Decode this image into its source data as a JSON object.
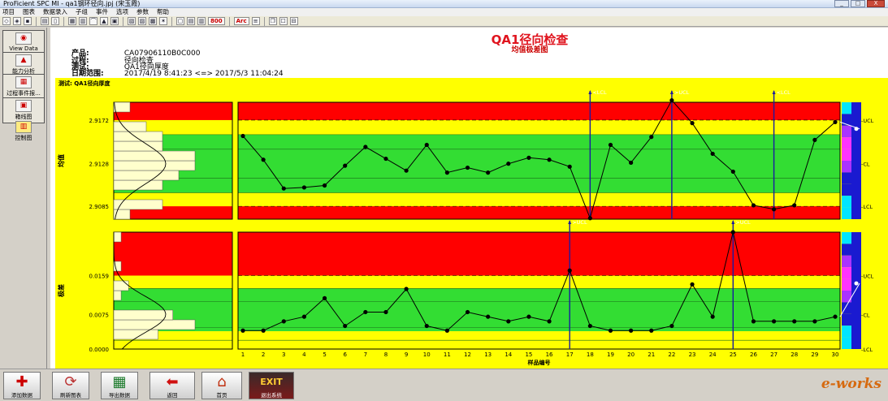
{
  "window": {
    "title": "ProFicient SPC MI - qa1钢环径向.jpj (宋玉霞)",
    "buttons": [
      "_",
      "□",
      "X"
    ]
  },
  "menu": [
    "项目",
    "图表",
    "数据录入",
    "子组",
    "事件",
    "选项",
    "参数",
    "帮助"
  ],
  "toolbar": {
    "text_button_1": "800",
    "text_button_2": "Arc"
  },
  "sidebar": {
    "items": [
      {
        "label": "View Data",
        "icon": "view-data-icon"
      },
      {
        "label": "能力分析",
        "icon": "capability-icon"
      },
      {
        "label": "过程事件报...",
        "icon": "process-event-icon"
      },
      {
        "label": "箱线图",
        "icon": "boxplot-icon"
      },
      {
        "label": "控制图",
        "icon": "control-chart-icon"
      }
    ]
  },
  "header": {
    "title": "QA1径向检查",
    "subtitle": "均值极差图",
    "product_label": "产品:",
    "product": "CA07906110B0C000",
    "process_label": "过程:",
    "process": "径向检查",
    "test_label": "测试:",
    "test": "QA1径向厚度",
    "date_label": "日期范围:",
    "date_range": "2017/4/19  8:41:23 <=> 2017/5/3  11:04:24"
  },
  "chart_data": {
    "type": "line",
    "test_title": "测试: QA1径向厚度",
    "xlabel": "样品编号",
    "x": [
      1,
      2,
      3,
      4,
      5,
      6,
      7,
      8,
      9,
      10,
      11,
      12,
      13,
      14,
      15,
      16,
      17,
      18,
      19,
      20,
      21,
      22,
      23,
      24,
      25,
      26,
      27,
      28,
      29,
      30
    ],
    "xbar": {
      "ylabel": "均值",
      "yticks": [
        "2.9172",
        "2.9128",
        "2.9085"
      ],
      "ylim": [
        2.9072,
        2.919
      ],
      "ucl": 2.9172,
      "cl": 2.9128,
      "lcl": 2.9085,
      "values": [
        2.9156,
        2.9132,
        2.9103,
        2.9104,
        2.9106,
        2.9126,
        2.9145,
        2.9133,
        2.9121,
        2.9147,
        2.9119,
        2.9124,
        2.9119,
        2.9128,
        2.9134,
        2.9132,
        2.9125,
        2.9073,
        2.9147,
        2.9129,
        2.9155,
        2.9192,
        2.9169,
        2.9138,
        2.912,
        2.9086,
        2.9082,
        2.9086,
        2.9152,
        2.917
      ],
      "annotations": [
        {
          "x": 18,
          "label": "<LCL"
        },
        {
          "x": 22,
          "label": ">UCL"
        },
        {
          "x": 27,
          "label": "<LCL"
        }
      ],
      "right_labels": [
        "UCL",
        "CL",
        "LCL"
      ]
    },
    "range": {
      "ylabel": "极差",
      "yticks": [
        "0.0159",
        "0.0075",
        "0.0000"
      ],
      "ylim": [
        0,
        0.0253
      ],
      "ucl": 0.0159,
      "cl": 0.0075,
      "lcl": 0.0,
      "values": [
        0.004,
        0.004,
        0.006,
        0.007,
        0.011,
        0.005,
        0.008,
        0.008,
        0.013,
        0.005,
        0.004,
        0.008,
        0.007,
        0.006,
        0.007,
        0.006,
        0.017,
        0.005,
        0.004,
        0.004,
        0.004,
        0.005,
        0.014,
        0.007,
        0.0253,
        0.006,
        0.006,
        0.006,
        0.006,
        0.007
      ],
      "annotations": [
        {
          "x": 17,
          "label": ">UCL"
        },
        {
          "x": 25,
          "label": ">UCL"
        }
      ],
      "right_labels": [
        "UCL",
        "CL",
        "LCL"
      ]
    },
    "zone_colors": {
      "out": "#ff0000",
      "warn": "#ffff00",
      "zone_a": "#66dd22",
      "zone_b": "#33dd33",
      "zone_c": "#22ee22"
    },
    "line_color": "#000000",
    "annotation_color": "#1a1aa0"
  },
  "bottom": {
    "buttons": [
      {
        "label": "添加数据",
        "icon": "add-data-icon"
      },
      {
        "label": "刷新图表",
        "icon": "refresh-icon"
      },
      {
        "label": "导出数据",
        "icon": "excel-export-icon"
      },
      {
        "label": "返回",
        "icon": "back-arrow-icon"
      },
      {
        "label": "首页",
        "icon": "home-icon"
      },
      {
        "label": "退出系统",
        "icon": "exit-icon"
      }
    ],
    "logo": "e-works"
  }
}
